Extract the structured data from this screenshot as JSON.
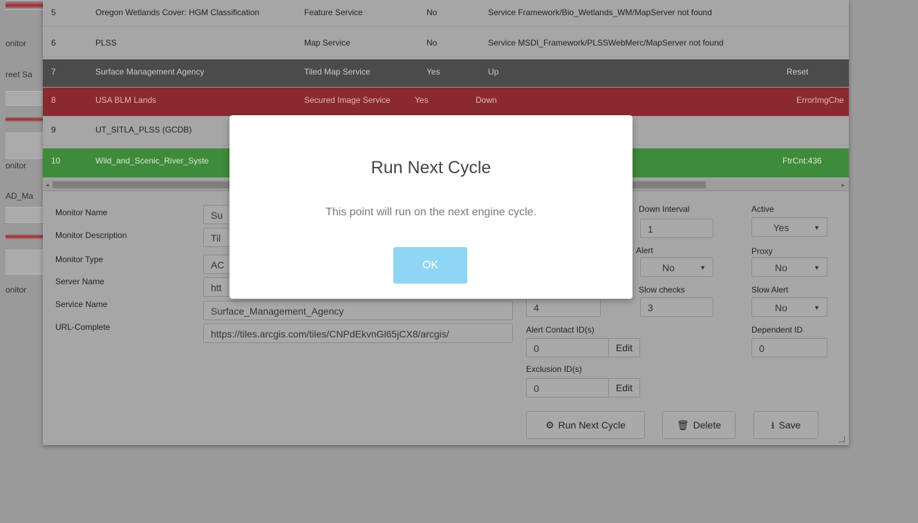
{
  "left_panel": {
    "items": [
      {
        "label": "onitor"
      },
      {
        "label": "reet Sa"
      },
      {
        "label": "onitor"
      },
      {
        "label": "AD_Ma"
      },
      {
        "label": "onitor"
      }
    ]
  },
  "table": {
    "rows": [
      {
        "num": "5",
        "name": "Oregon Wetlands Cover: HGM Classification",
        "type": "Feature Service",
        "secured": "No",
        "status": "Service Framework/Bio_Wetlands_WM/MapServer not found",
        "extra": "",
        "style": "normal"
      },
      {
        "num": "6",
        "name": "PLSS",
        "type": "Map Service",
        "secured": "No",
        "status": "Service MSDI_Framework/PLSSWebMerc/MapServer not found",
        "extra": "",
        "style": "normal"
      },
      {
        "num": "7",
        "name": "Surface Management Agency",
        "type": "Tiled Map Service",
        "secured": "Yes",
        "status": "Up",
        "extra": "Reset",
        "style": "dark"
      },
      {
        "num": "8",
        "name": "USA BLM Lands",
        "type": "Secured Image Service",
        "secured": "Yes",
        "status": "Down",
        "extra": "ErrorImgChe",
        "style": "red"
      },
      {
        "num": "9",
        "name": "UT_SITLA_PLSS (GCDB)",
        "type": "",
        "secured": "",
        "status": "",
        "extra": "",
        "style": "normal"
      },
      {
        "num": "10",
        "name": "Wild_and_Scenic_River_Syste",
        "type": "",
        "secured": "",
        "status": "",
        "extra": "FtrCnt:436",
        "style": "green"
      }
    ]
  },
  "form": {
    "labels": {
      "monitor_name": "Monitor Name",
      "monitor_description": "Monitor Description",
      "monitor_type": "Monitor Type",
      "server_name": "Server Name",
      "service_name": "Service Name",
      "url_complete": "URL-Complete",
      "down_interval": "Down Interval",
      "active": "Active",
      "alert": "Alert",
      "proxy": "Proxy",
      "slow_checks": "Slow checks",
      "slow_alert": "Slow Alert",
      "alert_contact": "Alert Contact ID(s)",
      "dependent_id": "Dependent ID",
      "exclusion": "Exclusion ID(s)"
    },
    "values": {
      "monitor_name": "Su",
      "monitor_description": "Til",
      "monitor_type": "AC",
      "server_name": "htt",
      "service_name": "Surface_Management_Agency",
      "url_complete": "https://tiles.arcgis.com/tiles/CNPdEkvnGl65jCX8/arcgis/",
      "down_interval": "1",
      "active": "Yes",
      "alert": "No",
      "proxy": "No",
      "check_field": "4",
      "slow_checks": "3",
      "slow_alert": "No",
      "alert_contact": "0",
      "dependent_id": "0",
      "exclusion": "0"
    },
    "edit_label": "Edit",
    "buttons": {
      "run_next_cycle": "Run Next Cycle",
      "delete": "Delete",
      "save": "Save"
    }
  },
  "modal": {
    "title": "Run Next Cycle",
    "message": "This point will run on the next engine cycle.",
    "ok_label": "OK"
  },
  "icons": {
    "run": "gear-icon",
    "delete": "trash-icon",
    "save": "download-icon"
  }
}
